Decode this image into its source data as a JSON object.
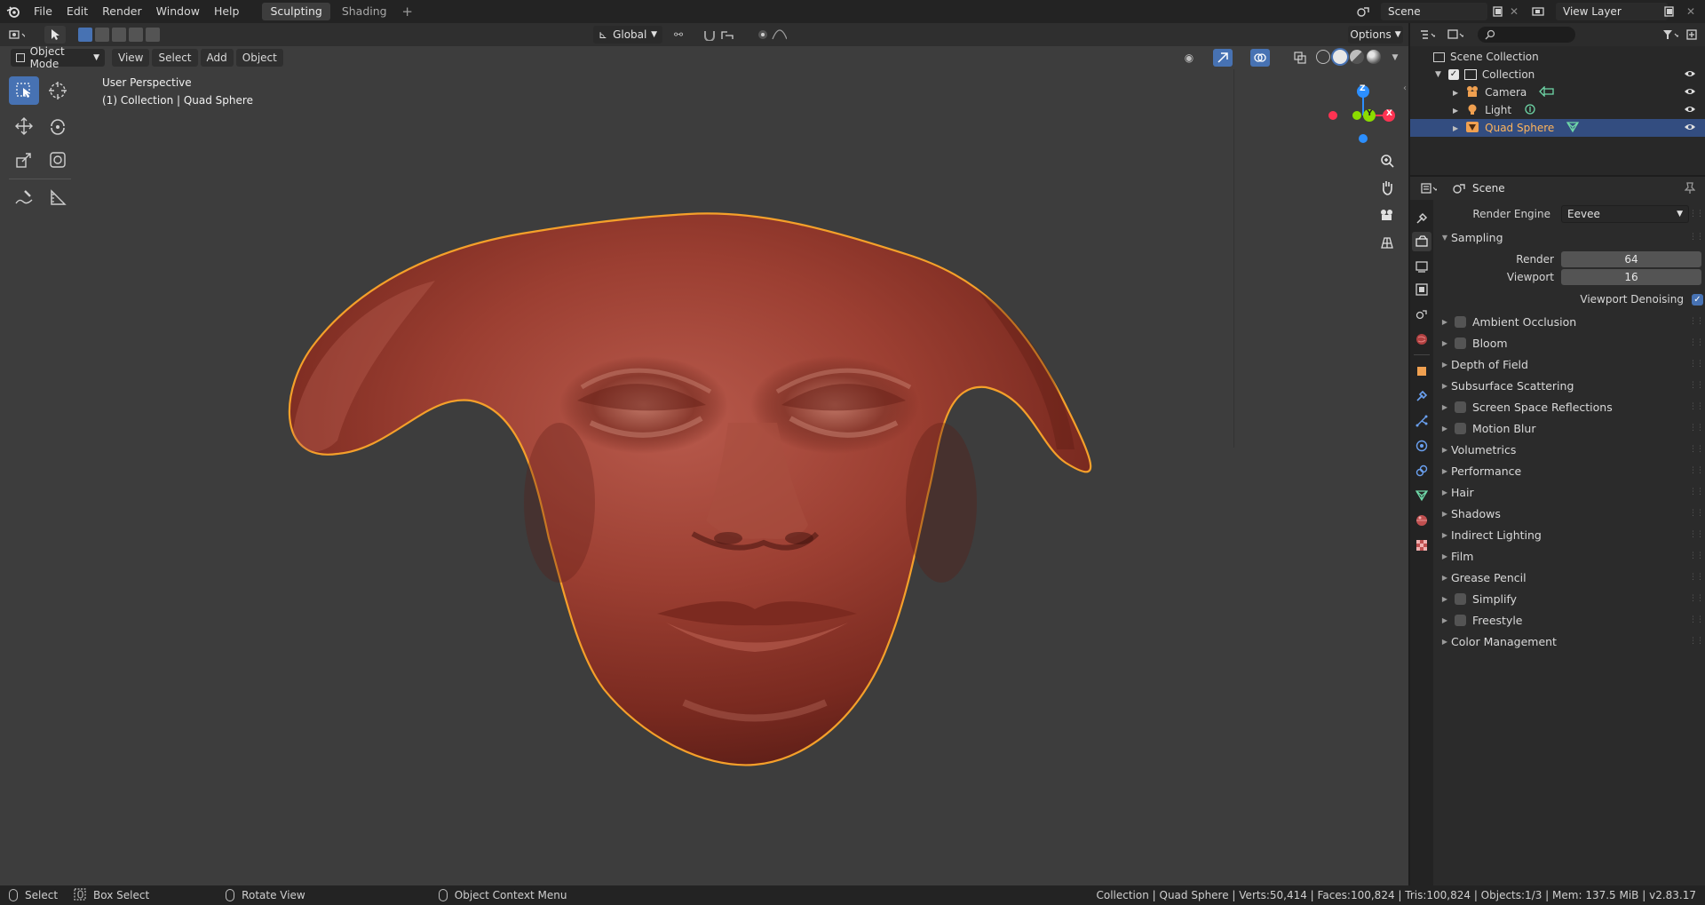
{
  "topbar": {
    "menus": [
      "File",
      "Edit",
      "Render",
      "Window",
      "Help"
    ],
    "workspaces": [
      {
        "label": "Sculpting",
        "active": true
      },
      {
        "label": "Shading",
        "active": false
      }
    ],
    "add_workspace": "+",
    "scene_name": "Scene",
    "view_layer": "View Layer"
  },
  "viewport": {
    "transform_orientation": "Global",
    "options_label": "Options",
    "mode": "Object Mode",
    "menus": [
      "View",
      "Select",
      "Add",
      "Object"
    ],
    "perspective_label": "User Perspective",
    "collection_label": "(1) Collection | Quad Sphere",
    "gizmo_axes": {
      "z": "Z",
      "y": "Y",
      "x": "X"
    },
    "colors": {
      "selection_outline": "#f5a02a",
      "mesh": "#9a3a2e",
      "bg": "#3d3d3d"
    }
  },
  "outliner": {
    "search_placeholder": "",
    "root": "Scene Collection",
    "items": [
      {
        "label": "Collection",
        "indent": 1,
        "icon": "collection-icon",
        "checked": true
      },
      {
        "label": "Camera",
        "indent": 2,
        "icon": "camera-icon"
      },
      {
        "label": "Light",
        "indent": 2,
        "icon": "light-icon"
      },
      {
        "label": "Quad Sphere",
        "indent": 2,
        "icon": "mesh-icon",
        "selected": true
      }
    ]
  },
  "properties": {
    "context": "Scene",
    "render_engine_label": "Render Engine",
    "render_engine": "Eevee",
    "sampling": {
      "title": "Sampling",
      "render_label": "Render",
      "render_value": "64",
      "viewport_label": "Viewport",
      "viewport_value": "16",
      "denoise_label": "Viewport Denoising",
      "denoise_checked": true
    },
    "panels": [
      {
        "label": "Ambient Occlusion",
        "checkbox": true
      },
      {
        "label": "Bloom",
        "checkbox": true
      },
      {
        "label": "Depth of Field",
        "checkbox": false
      },
      {
        "label": "Subsurface Scattering",
        "checkbox": false
      },
      {
        "label": "Screen Space Reflections",
        "checkbox": true
      },
      {
        "label": "Motion Blur",
        "checkbox": true
      },
      {
        "label": "Volumetrics",
        "checkbox": false
      },
      {
        "label": "Performance",
        "checkbox": false
      },
      {
        "label": "Hair",
        "checkbox": false
      },
      {
        "label": "Shadows",
        "checkbox": false
      },
      {
        "label": "Indirect Lighting",
        "checkbox": false
      },
      {
        "label": "Film",
        "checkbox": false
      },
      {
        "label": "Grease Pencil",
        "checkbox": false
      },
      {
        "label": "Simplify",
        "checkbox": true
      },
      {
        "label": "Freestyle",
        "checkbox": true
      },
      {
        "label": "Color Management",
        "checkbox": false
      }
    ]
  },
  "statusbar": {
    "select": "Select",
    "box_select": "Box Select",
    "rotate_view": "Rotate View",
    "context_menu": "Object Context Menu",
    "stats": "Collection | Quad Sphere | Verts:50,414 | Faces:100,824 | Tris:100,824 | Objects:1/3 | Mem: 137.5 MiB | v2.83.17"
  }
}
